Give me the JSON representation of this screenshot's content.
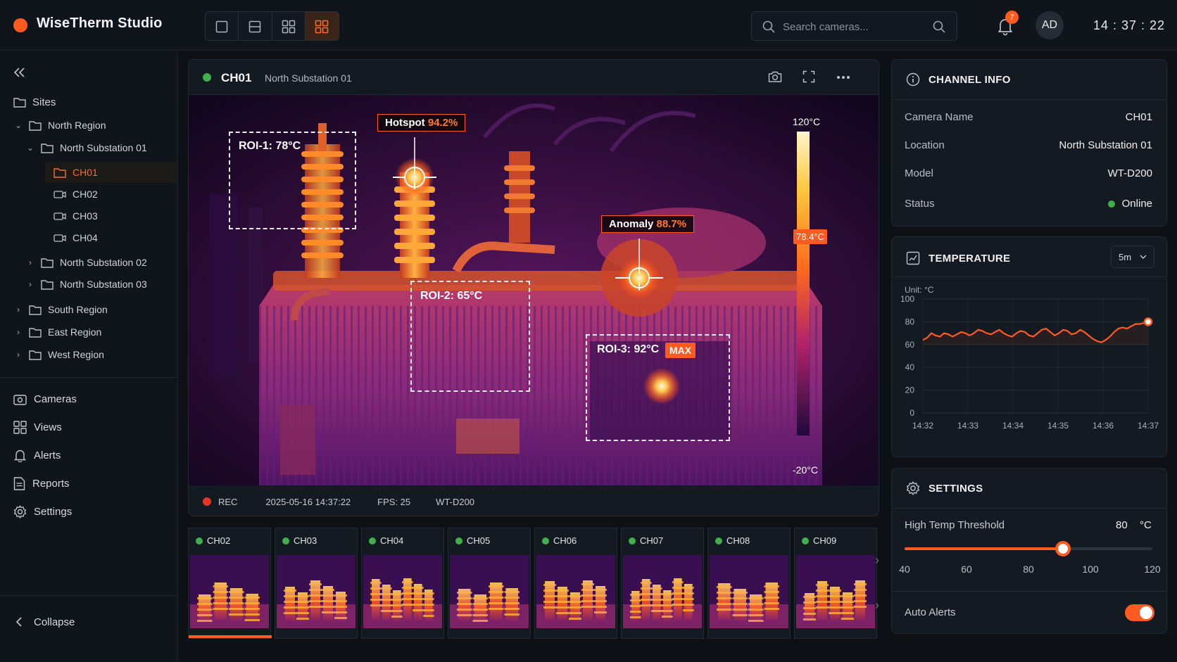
{
  "app": {
    "title": "WiseTherm Studio",
    "brand_color": "#ff5a1f"
  },
  "header": {
    "layouts": [
      "single-view-icon",
      "split-view-icon",
      "quad-view-icon",
      "grid-view-icon"
    ],
    "active_layout": "grid-view-icon",
    "search_placeholder": "Search cameras...",
    "notifications_count": "7",
    "avatar_initials": "AD",
    "clock": "14 : 37 : 22"
  },
  "sidebar": {
    "sites_label": "Sites",
    "tree": {
      "north_region": "North Region",
      "north_substation_01": "North Substation 01",
      "channels": [
        "CH01",
        "CH02",
        "CH03",
        "CH04"
      ],
      "selected_channel": "CH01",
      "north_substation_02": "North Substation 02",
      "north_substation_03": "North Substation 03",
      "south_region": "South Region",
      "east_region": "East Region",
      "west_region": "West Region"
    },
    "nav": [
      "Cameras",
      "Views",
      "Alerts",
      "Reports",
      "Settings"
    ],
    "collapse_label": "Collapse"
  },
  "viewer": {
    "channel": "CH01",
    "location": "North Substation 01",
    "status_color": "#3fb04b",
    "roi_1": "ROI-1: 78°C",
    "roi_2": "ROI-2: 65°C",
    "roi_3": "ROI-3: 92°C",
    "max_badge": "MAX",
    "hotspot_label": "Hotspot",
    "hotspot_value": "94.2%",
    "anomaly_label": "Anomaly",
    "anomaly_value": "88.7%",
    "scale_max": "120°C",
    "scale_min": "-20°C",
    "scale_marker": "78.4°C",
    "rec_label": "REC",
    "timestamp": "2025-05-16 14:37:22",
    "fps": "FPS: 25",
    "model": "WT-D200"
  },
  "thumbnails": [
    "CH02",
    "CH03",
    "CH04",
    "CH05",
    "CH06",
    "CH07",
    "CH08",
    "CH09"
  ],
  "channel_info": {
    "title": "CHANNEL INFO",
    "rows": [
      {
        "key": "Camera Name",
        "value": "CH01"
      },
      {
        "key": "Location",
        "value": "North Substation 01"
      },
      {
        "key": "Model",
        "value": "WT-D200"
      },
      {
        "key": "Status",
        "value": "Online"
      }
    ]
  },
  "temperature": {
    "title": "TEMPERATURE",
    "range_select": "5m",
    "unit": "Unit: °C"
  },
  "chart_data": {
    "type": "line",
    "title": "TEMPERATURE",
    "xlabel": "",
    "ylabel": "Unit: °C",
    "ylim": [
      0,
      100
    ],
    "y_ticks": [
      "100",
      "80",
      "60",
      "40",
      "20",
      "0"
    ],
    "x_ticks": [
      "14:32",
      "14:33",
      "14:34",
      "14:35",
      "14:36",
      "14:37"
    ],
    "series": [
      {
        "values": [
          64,
          66,
          70,
          68,
          67,
          70,
          69,
          67,
          69,
          71,
          70,
          68,
          70,
          73,
          72,
          70,
          69,
          71,
          73,
          70,
          68,
          67,
          70,
          72,
          71,
          68,
          67,
          70,
          73,
          74,
          71,
          68,
          70,
          73,
          72,
          69,
          70,
          73,
          71,
          68,
          65,
          63,
          62,
          64,
          67,
          71,
          74,
          75,
          74,
          76,
          78,
          78,
          79,
          80
        ],
        "color": "#ff5a1f"
      }
    ],
    "grid": true
  },
  "settings": {
    "title": "SETTINGS",
    "threshold_label": "High Temp Threshold",
    "threshold_value": "80",
    "threshold_unit": "°C",
    "threshold_fraction": 0.64,
    "slider_ticks": [
      "40",
      "60",
      "80",
      "100",
      "120"
    ],
    "auto_alerts_label": "Auto Alerts",
    "auto_alerts_on": true
  }
}
